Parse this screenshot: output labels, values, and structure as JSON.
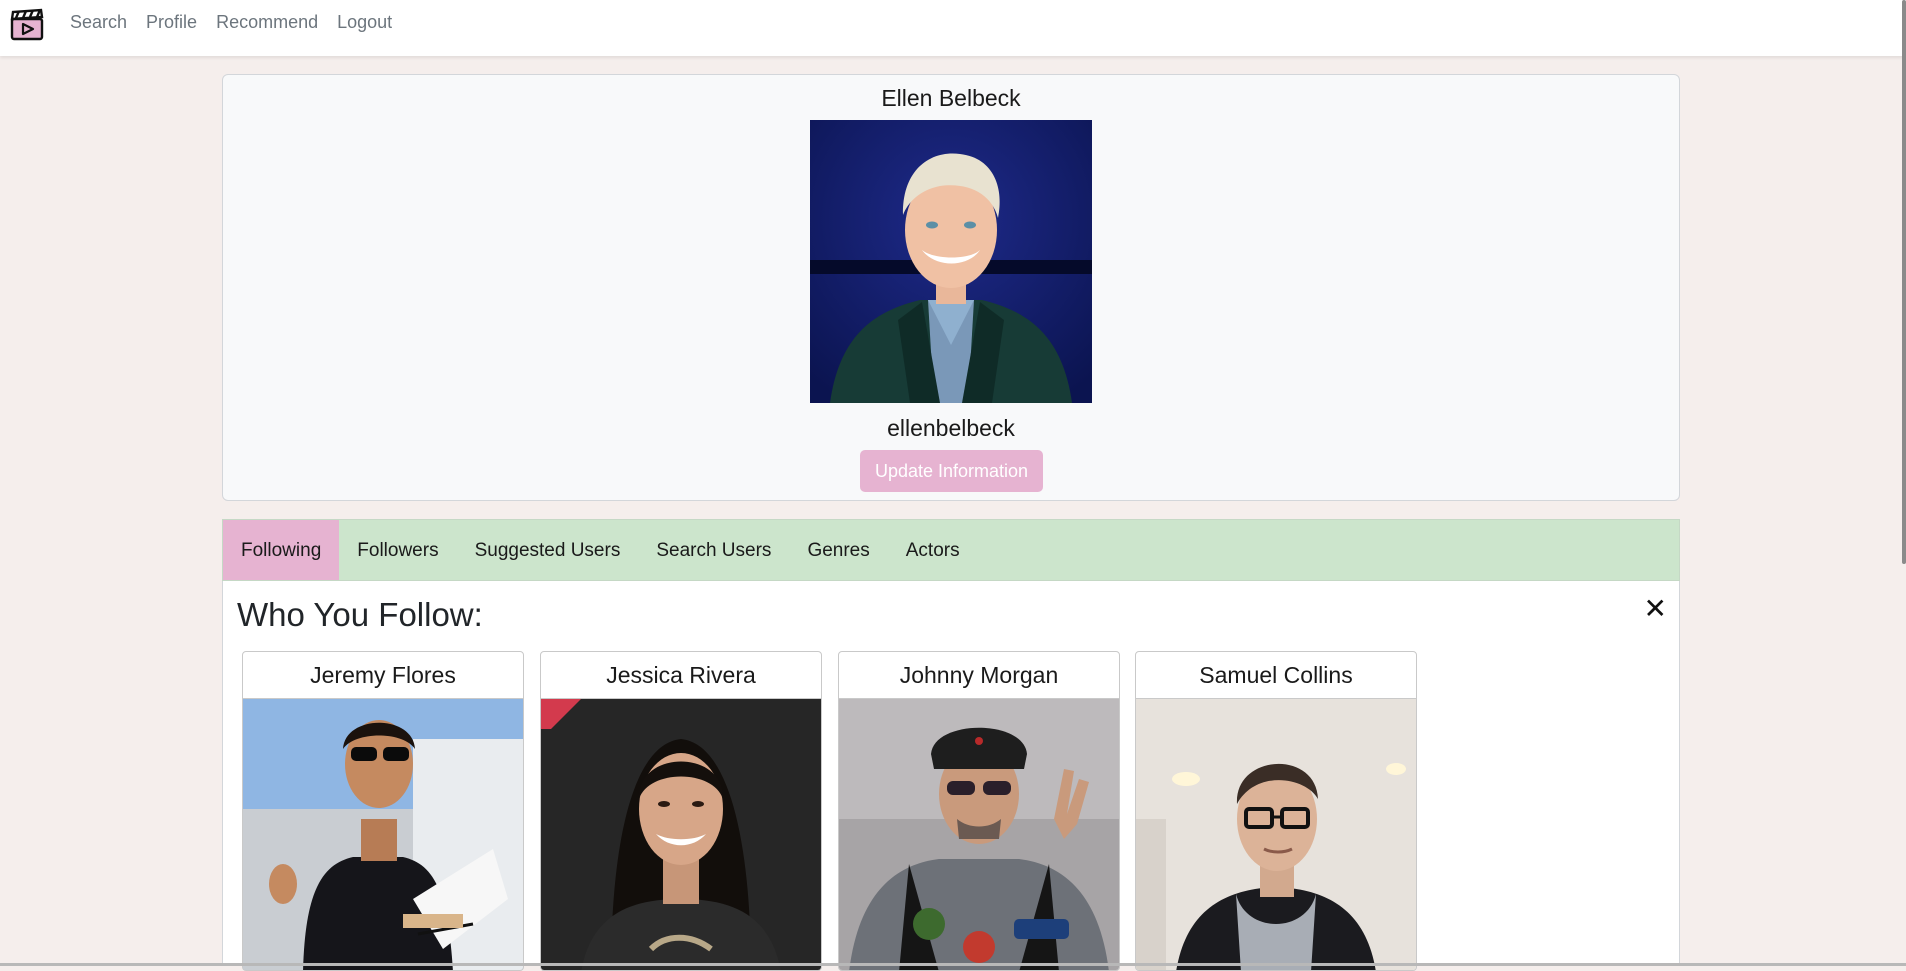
{
  "nav": {
    "links": [
      "Search",
      "Profile",
      "Recommend",
      "Logout"
    ]
  },
  "profile": {
    "name": "Ellen Belbeck",
    "username": "ellenbelbeck",
    "update_button": "Update Information"
  },
  "tabs": [
    "Following",
    "Followers",
    "Suggested Users",
    "Search Users",
    "Genres",
    "Actors"
  ],
  "active_tab": "Following",
  "panel": {
    "title": "Who You Follow:",
    "close_symbol": "✕"
  },
  "following": [
    {
      "name": "Jeremy Flores"
    },
    {
      "name": "Jessica Rivera"
    },
    {
      "name": "Johnny Morgan"
    },
    {
      "name": "Samuel Collins"
    }
  ],
  "colors": {
    "accent_pink": "#e6b3d1",
    "tab_bar_green": "#cce5cc",
    "page_bg": "#f5eeec"
  },
  "icons": {
    "logo": "clapperboard-play-icon",
    "close": "close-icon"
  }
}
